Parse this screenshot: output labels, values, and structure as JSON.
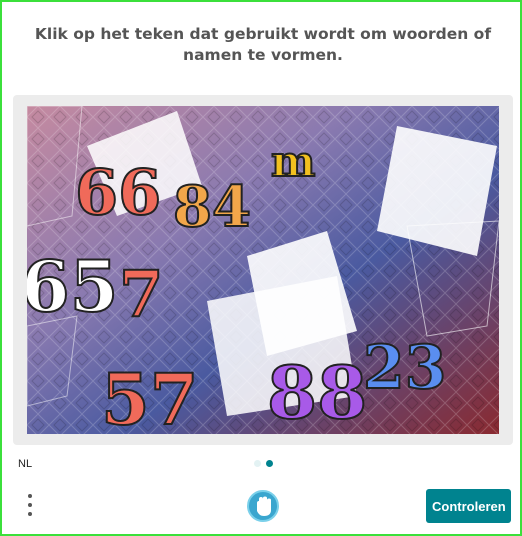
{
  "challenge": {
    "prompt": "Klik op het teken dat gebruikt wordt om woorden of namen te vormen.",
    "image_glyphs": [
      {
        "text": "66",
        "color": "#f06a5a"
      },
      {
        "text": "84",
        "color": "#f2a64a"
      },
      {
        "text": "m",
        "color": "#f2c020"
      },
      {
        "text": "65",
        "color": "#ffffff"
      },
      {
        "text": "7",
        "color": "#f06a5a"
      },
      {
        "text": "57",
        "color": "#f06a5a"
      },
      {
        "text": "88",
        "color": "#a85ae8"
      },
      {
        "text": "23",
        "color": "#5a8ef0"
      }
    ]
  },
  "footer": {
    "language": "NL",
    "pagination": {
      "total": 2,
      "active": 2
    },
    "submit_label": "Controleren"
  },
  "colors": {
    "accent": "#00838f",
    "border": "#3be03b",
    "dot_active": "#00838f",
    "dot_inactive": "#e3f2f3"
  },
  "icons": {
    "menu": "vertical-ellipsis-icon",
    "accessibility": "hand-icon"
  }
}
